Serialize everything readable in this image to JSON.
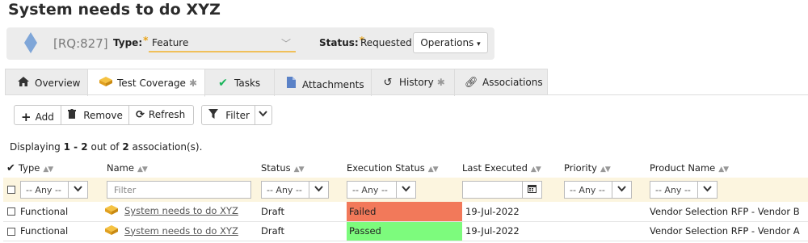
{
  "page": {
    "title": "System needs to do XYZ"
  },
  "header": {
    "id": "[RQ:827]",
    "type_label": "Type:",
    "type_value": "Feature",
    "status_label": "Status:",
    "status_value": "Requested",
    "operations_label": "Operations",
    "required_mark": "*"
  },
  "tabs": [
    {
      "label": "Overview",
      "icon": "home-icon"
    },
    {
      "label": "Test Coverage",
      "icon": "test-case-icon",
      "star": "✱",
      "active": true
    },
    {
      "label": "Tasks",
      "icon": "check-icon"
    },
    {
      "label": "Attachments",
      "icon": "document-icon"
    },
    {
      "label": "History",
      "icon": "history-icon",
      "star": "✱"
    },
    {
      "label": "Associations",
      "icon": "link-icon"
    }
  ],
  "toolbar": {
    "add_label": "Add",
    "remove_label": "Remove",
    "refresh_label": "Refresh",
    "filter_label": "Filter"
  },
  "display": {
    "prefix": "Displaying ",
    "range": "1 - 2",
    "middle": " out of ",
    "total": "2",
    "suffix": " association(s)."
  },
  "grid": {
    "columns": [
      "Type",
      "Name",
      "Status",
      "Execution Status",
      "Last Executed",
      "Priority",
      "Product Name"
    ],
    "filters": {
      "any": "-- Any --",
      "name_placeholder": "Filter"
    },
    "rows": [
      {
        "type": "Functional",
        "name": "System needs to do XYZ",
        "status": "Draft",
        "execution_status": "Failed",
        "last_executed": "19-Jul-2022",
        "priority": "",
        "product": "Vendor Selection RFP - Vendor B"
      },
      {
        "type": "Functional",
        "name": "System needs to do XYZ",
        "status": "Draft",
        "execution_status": "Passed",
        "last_executed": "19-Jul-2022",
        "priority": "",
        "product": "Vendor Selection RFP - Vendor A"
      }
    ]
  },
  "colors": {
    "failed": "#f2795a",
    "passed": "#7dfb7d",
    "filter_row": "#fcf5df",
    "accent": "#f0c05a"
  }
}
